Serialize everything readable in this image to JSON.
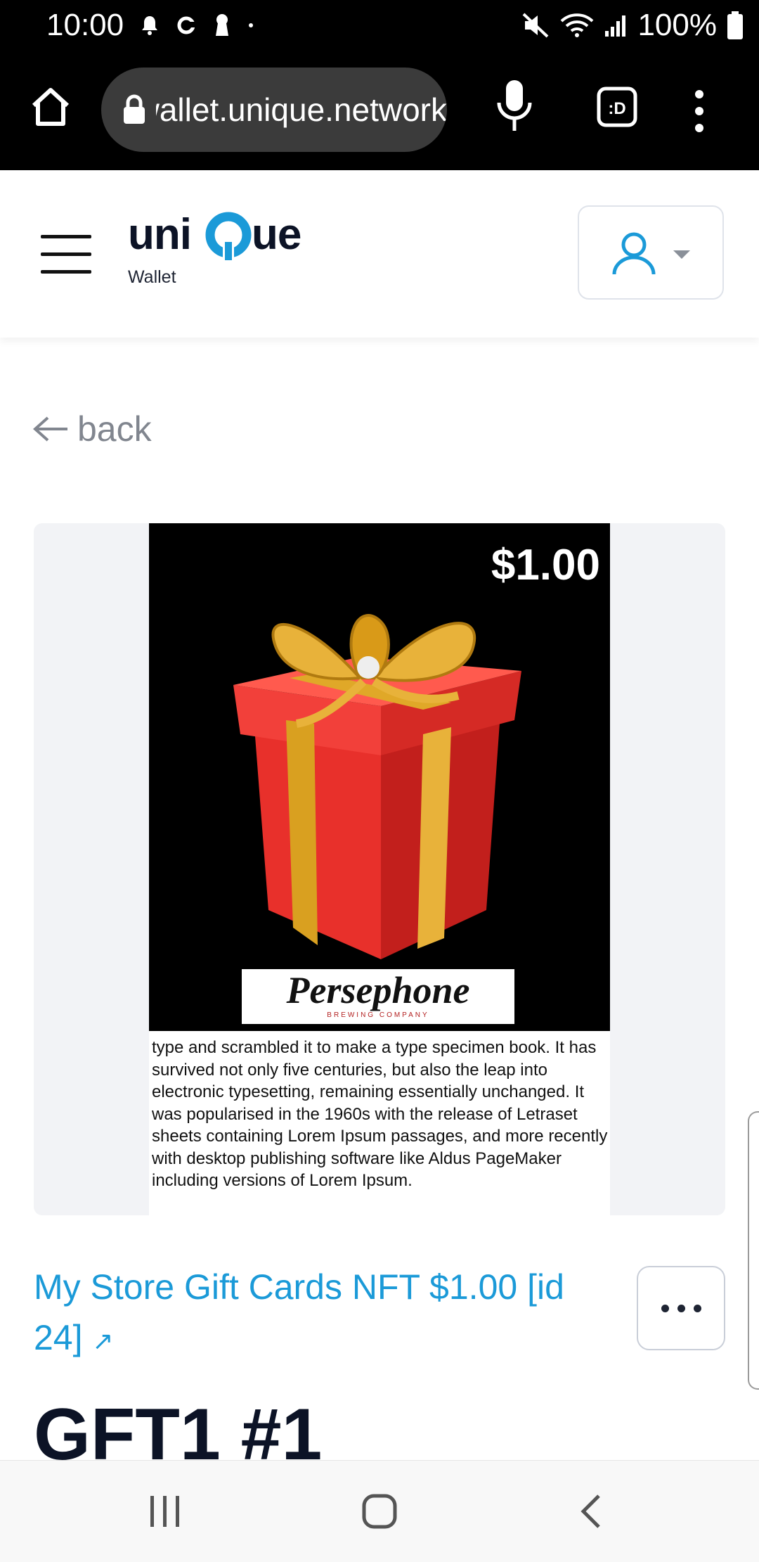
{
  "status_bar": {
    "time": "10:00",
    "battery": "100%",
    "icons": [
      "notification-bell-icon",
      "sync-icon",
      "keyhole-icon",
      "dot-icon",
      "mute-icon",
      "wifi-icon",
      "signal-icon",
      "battery-icon"
    ]
  },
  "browser": {
    "url": "wallet.unique.network",
    "home_icon": "home-icon",
    "lock_icon": "lock-icon",
    "mic_icon": "mic-icon",
    "tabs_icon": "tabs-icon",
    "menu_icon": "more-vertical-icon"
  },
  "header": {
    "logo_text": "unique",
    "logo_sub": "Wallet",
    "brand_color": "#1b9ad8",
    "account_icon": "user-icon"
  },
  "nav": {
    "back_label": "back"
  },
  "nft_image": {
    "price": "$1.00",
    "brand": "Persephone",
    "brand_sub": "BREWING COMPANY",
    "description": "type and scrambled it to make a type specimen book. It has survived not only five centuries, but also the leap into electronic typesetting, remaining essentially unchanged. It was popularised in the 1960s with the release of Letraset sheets containing Lorem Ipsum passages, and more recently with desktop publishing software like Aldus PageMaker including versions of Lorem Ipsum."
  },
  "token": {
    "collection_link": "My Store Gift Cards NFT $1.00 [id 24]",
    "collection_arrow": "↗",
    "title": "GFT1 #1"
  },
  "system_nav": {
    "recent_icon": "recent-apps-icon",
    "home_icon": "home-circle-icon",
    "back_icon": "back-chevron-icon"
  }
}
